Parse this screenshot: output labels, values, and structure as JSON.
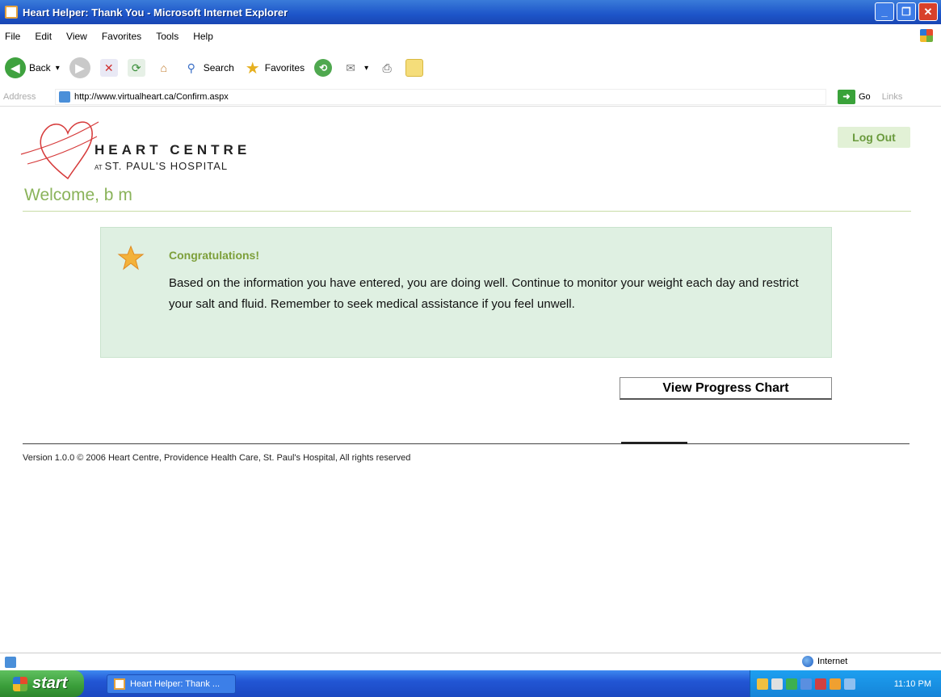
{
  "window": {
    "title": "Heart Helper: Thank You - Microsoft Internet Explorer"
  },
  "menu": [
    "File",
    "Edit",
    "View",
    "Favorites",
    "Tools",
    "Help"
  ],
  "toolbar": {
    "back": "Back",
    "search": "Search",
    "favorites": "Favorites"
  },
  "address": {
    "label": "Address",
    "url": "http://www.virtualheart.ca/Confirm.aspx",
    "go": "Go",
    "links": "Links"
  },
  "logo": {
    "main": "HEART CENTRE",
    "prefix": "AT",
    "sub": "ST. PAUL'S HOSPITAL"
  },
  "logout": "Log Out",
  "welcome": "Welcome, b m",
  "alert": {
    "heading": "Congratulations!",
    "message": "Based on the information you have entered, you are doing well. Continue to monitor your weight each day and restrict your salt and fluid. Remember to seek medical assistance if you feel unwell."
  },
  "progress_button": "View Progress Chart",
  "footer": "Version 1.0.0 © 2006 Heart Centre, Providence Health Care, St. Paul's Hospital, All rights reserved",
  "status": {
    "zone": "Internet"
  },
  "taskbar": {
    "start": "start",
    "task": "Heart Helper: Thank ...",
    "clock": "11:10 PM"
  }
}
